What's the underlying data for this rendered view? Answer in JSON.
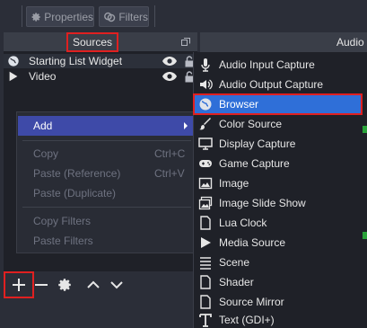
{
  "toolbar": {
    "properties_label": "Properties",
    "filters_label": "Filters"
  },
  "sources": {
    "title": "Sources",
    "items": [
      {
        "label": "Starting List Widget",
        "icon": "globe-icon"
      },
      {
        "label": "Video",
        "icon": "play-icon"
      }
    ]
  },
  "audio": {
    "title": "Audio"
  },
  "context_menu": {
    "items": [
      {
        "label": "Add",
        "shortcut": "",
        "state": "active"
      },
      {
        "label": "Copy",
        "shortcut": "Ctrl+C",
        "state": "disabled"
      },
      {
        "label": "Paste (Reference)",
        "shortcut": "Ctrl+V",
        "state": "disabled"
      },
      {
        "label": "Paste (Duplicate)",
        "shortcut": "",
        "state": "disabled"
      },
      {
        "label": "Copy Filters",
        "shortcut": "",
        "state": "disabled"
      },
      {
        "label": "Paste Filters",
        "shortcut": "",
        "state": "disabled"
      }
    ]
  },
  "add_submenu": {
    "items": [
      {
        "label": "Audio Input Capture",
        "icon": "microphone-icon"
      },
      {
        "label": "Audio Output Capture",
        "icon": "speaker-icon"
      },
      {
        "label": "Browser",
        "icon": "globe-icon",
        "selected": true
      },
      {
        "label": "Color Source",
        "icon": "paint-brush-icon"
      },
      {
        "label": "Display Capture",
        "icon": "monitor-icon"
      },
      {
        "label": "Game Capture",
        "icon": "gamepad-icon"
      },
      {
        "label": "Image",
        "icon": "image-icon"
      },
      {
        "label": "Image Slide Show",
        "icon": "slideshow-icon"
      },
      {
        "label": "Lua Clock",
        "icon": "file-icon"
      },
      {
        "label": "Media Source",
        "icon": "play-icon"
      },
      {
        "label": "Scene",
        "icon": "list-icon"
      },
      {
        "label": "Shader",
        "icon": "file-icon"
      },
      {
        "label": "Source Mirror",
        "icon": "file-icon"
      },
      {
        "label": "Text (GDI+)",
        "icon": "text-icon"
      }
    ]
  },
  "bottom_toolbar": {
    "buttons": [
      "add-source-button",
      "remove-source-button",
      "source-properties-button",
      "move-up-button",
      "move-down-button"
    ]
  },
  "colors": {
    "accent_selected": "#2f6fd8",
    "annotation_red": "#e02020",
    "panel_bg": "#1f2128",
    "chrome_bg": "#2b2e38"
  }
}
